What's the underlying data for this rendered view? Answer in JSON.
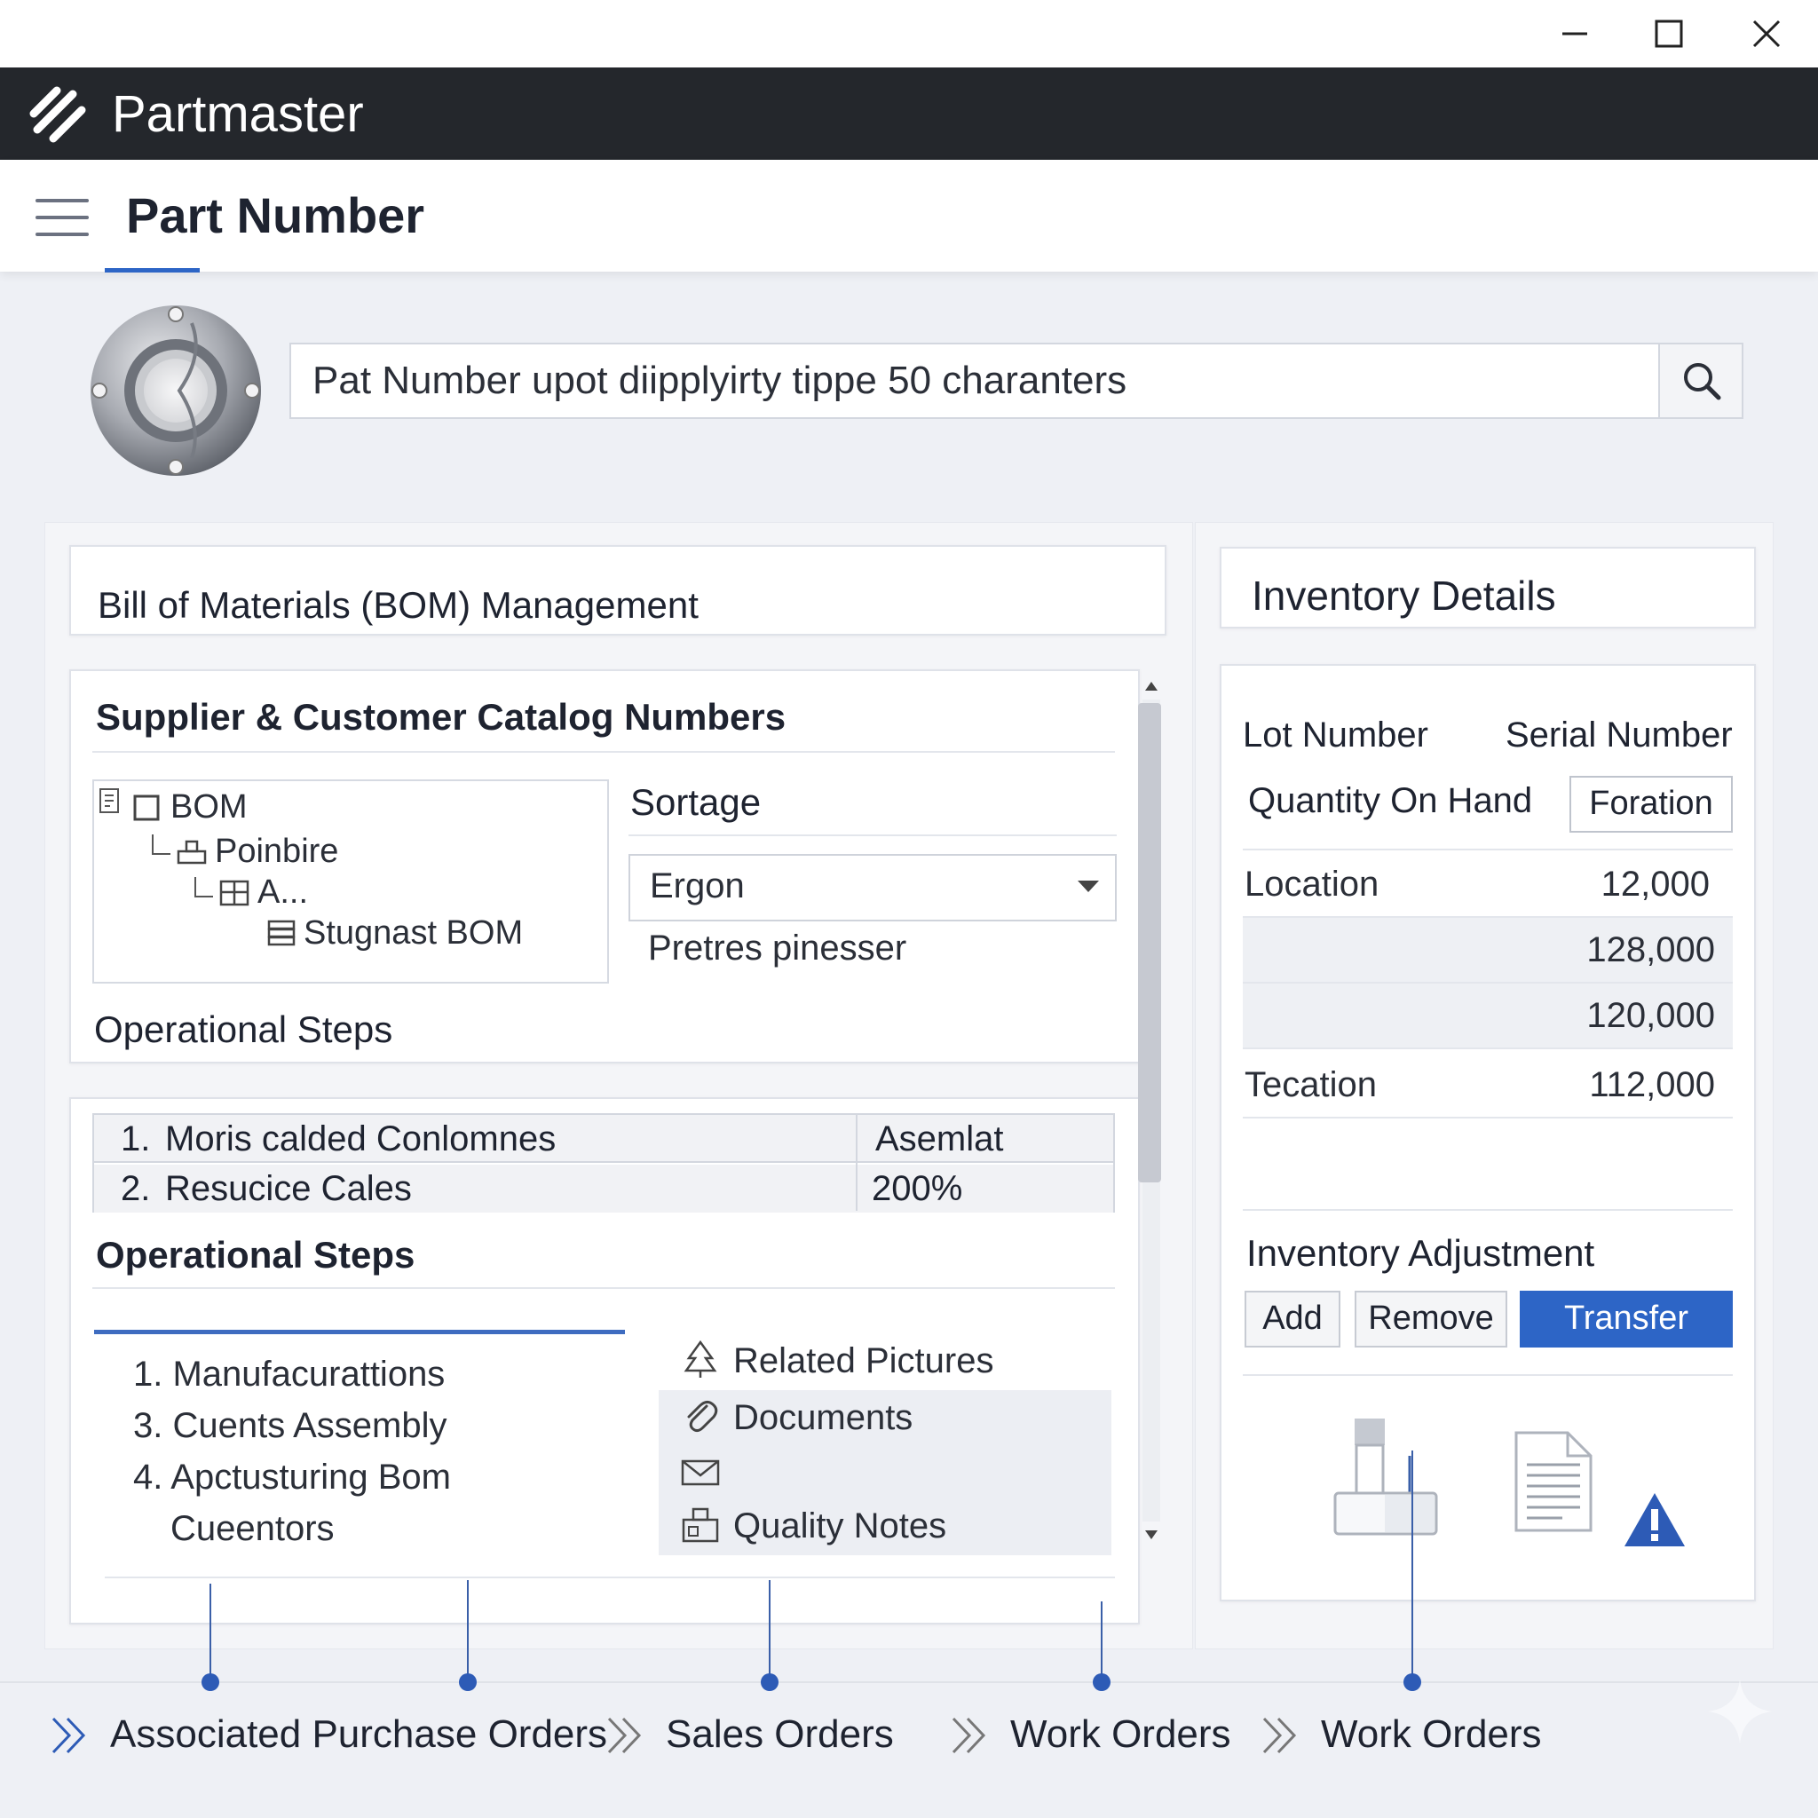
{
  "app": {
    "name": "Partmaster"
  },
  "page": {
    "title": "Part Number"
  },
  "search": {
    "value": "Pat Number upot diipplyirty tippe 50 charanters"
  },
  "bom": {
    "title": "Bill of Materials (BOM) Management",
    "supplier_title": "Supplier & Customer Catalog Numbers",
    "tree": [
      {
        "label": "BOM",
        "icon": "checkbox-icon"
      },
      {
        "label": "Poinbire",
        "icon": "component-icon"
      },
      {
        "label": "A...",
        "icon": "assembly-icon"
      },
      {
        "label": "Stugnast BOM",
        "icon": "stack-icon"
      }
    ],
    "sortage_label": "Sortage",
    "dropdown_value": "Ergon",
    "helper_text": "Pretres pinesser",
    "opsteps_title_1": "Operational Steps",
    "steps_table": [
      {
        "num": "1.",
        "name": "Moris calded Conlomnes",
        "value": "Asemlat"
      },
      {
        "num": "2.",
        "name": "Resucice Cales",
        "value": "200%"
      }
    ],
    "opsteps_title_2": "Operational Steps",
    "steps_list": [
      "1. Manufacurattions",
      "3. Cuents Assembly",
      "4. Apctusturing Bom",
      "Cueentors"
    ],
    "related": [
      {
        "label": "Related Pictures",
        "icon": "tree-icon"
      },
      {
        "label": "Documents",
        "icon": "paperclip-icon"
      },
      {
        "label": "",
        "icon": "envelope-icon"
      },
      {
        "label": "Quality Notes",
        "icon": "notes-icon"
      }
    ]
  },
  "inventory": {
    "title": "Inventory Details",
    "lot_label": "Lot Number",
    "serial_label": "Serial Number",
    "qoh_label": "Quantity On Hand",
    "foration_label": "Foration",
    "rows": [
      {
        "name": "Location",
        "value": "12,000"
      },
      {
        "name": "",
        "value": "128,000"
      },
      {
        "name": "",
        "value": "120,000"
      },
      {
        "name": "Tecation",
        "value": "112,000"
      }
    ],
    "adjustment_title": "Inventory Adjustment",
    "buttons": {
      "add": "Add",
      "remove": "Remove",
      "transfer": "Transfer"
    }
  },
  "bottom_nav": [
    "Associated Purchase Orders",
    "Sales Orders",
    "Work Orders",
    "Work Orders"
  ],
  "colors": {
    "header": "#24272c",
    "accent": "#2d65c6",
    "warning": "#2d5bb6"
  }
}
